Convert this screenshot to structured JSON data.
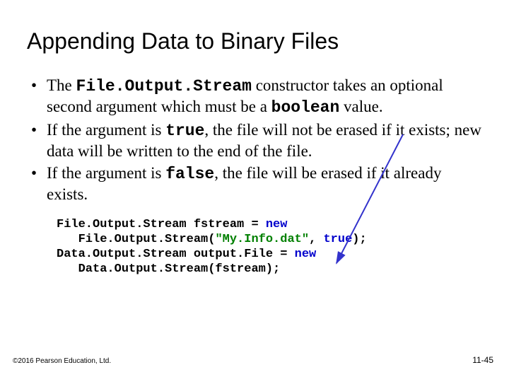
{
  "title": "Appending Data to Binary Files",
  "bullets": {
    "b1": {
      "t1": "The ",
      "code1": "File.Output.Stream",
      "t2": " constructor takes an optional second argument which must be a ",
      "code2": "boolean",
      "t3": " value."
    },
    "b2": {
      "t1": "If the argument is ",
      "code1": "true",
      "t2": ", the file will not be erased if it exists; new data will be written to the end of the file."
    },
    "b3": {
      "t1": "If the argument is ",
      "code1": "false",
      "t2": ", the file will be erased if it already exists."
    }
  },
  "code": {
    "l1a": "File.Output.Stream fstream = ",
    "l1b": "new",
    "l2a": "   File.Output.Stream(",
    "l2b": "\"My.Info.dat\"",
    "l2c": ", ",
    "l2d": "true",
    "l2e": ");",
    "l3a": "Data.Output.Stream output.File = ",
    "l3b": "new",
    "l4a": "   Data.Output.Stream(fstream);"
  },
  "footer": {
    "left": "©2016 Pearson Education, Ltd.",
    "right": "11-45"
  }
}
